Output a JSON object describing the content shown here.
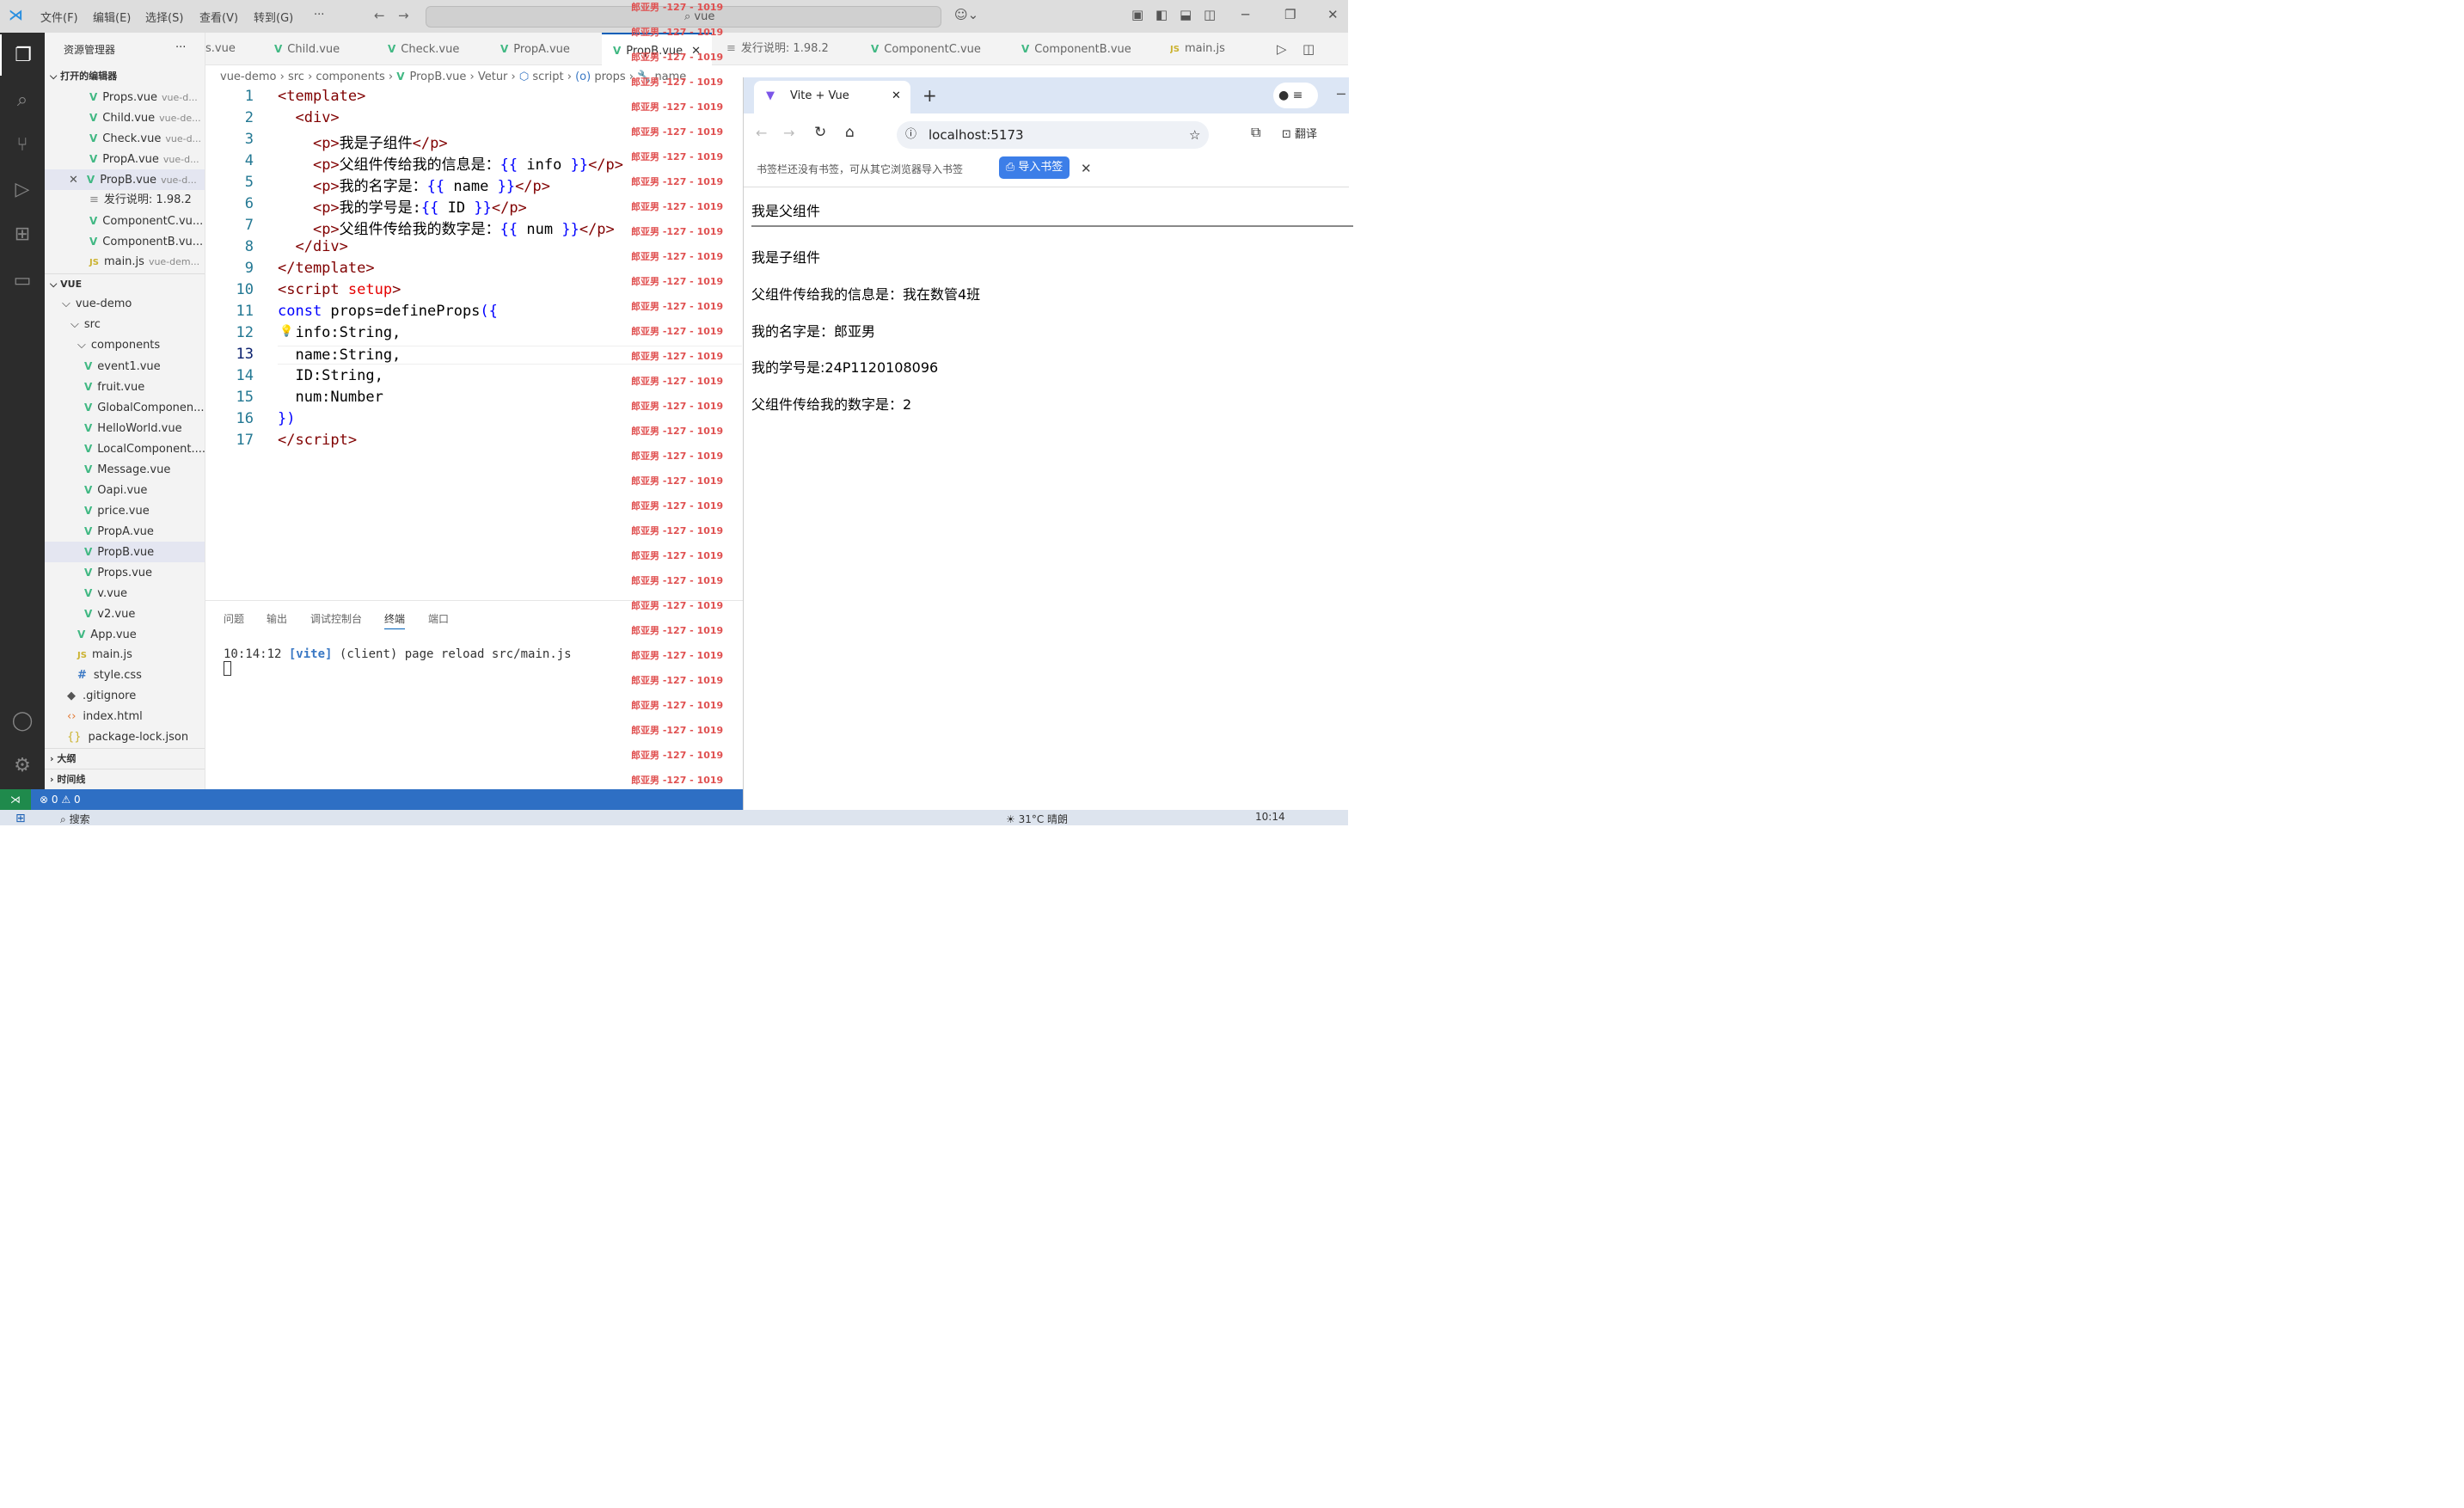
{
  "titlebar": {
    "menus": [
      "文件(F)",
      "编辑(E)",
      "选择(S)",
      "查看(V)",
      "转到(G)",
      "···"
    ],
    "search": "vue"
  },
  "sidebar": {
    "title": "资源管理器",
    "more": "···",
    "open_editors_header": "打开的编辑器",
    "open_editors": [
      {
        "name": "Props.vue",
        "path": "vue-d..."
      },
      {
        "name": "Child.vue",
        "path": "vue-de..."
      },
      {
        "name": "Check.vue",
        "path": "vue-d..."
      },
      {
        "name": "PropA.vue",
        "path": "vue-d..."
      },
      {
        "name": "PropB.vue",
        "path": "vue-d..."
      },
      {
        "name": "发行说明: 1.98.2",
        "path": ""
      },
      {
        "name": "ComponentC.vu...",
        "path": ""
      },
      {
        "name": "ComponentB.vu...",
        "path": ""
      },
      {
        "name": "main.js",
        "path": "vue-dem..."
      }
    ],
    "workspace_header": "VUE",
    "tree": [
      "vue-demo",
      "src",
      "components",
      "event1.vue",
      "fruit.vue",
      "GlobalComponen...",
      "HelloWorld.vue",
      "LocalComponent....",
      "Message.vue",
      "Oapi.vue",
      "price.vue",
      "PropA.vue",
      "PropB.vue",
      "Props.vue",
      "v.vue",
      "v2.vue",
      "App.vue",
      "main.js",
      "style.css",
      ".gitignore",
      "index.html",
      "package-lock.json"
    ],
    "outline": "大纲",
    "timeline": "时间线"
  },
  "tabs": [
    "s.vue",
    "Child.vue",
    "Check.vue",
    "PropA.vue",
    "PropB.vue",
    "发行说明: 1.98.2",
    "ComponentC.vue",
    "ComponentB.vue",
    "main.js"
  ],
  "breadcrumb": [
    "vue-demo",
    "src",
    "components",
    "PropB.vue",
    "Vetur",
    "script",
    "props",
    "name"
  ],
  "code": [
    "1",
    "2",
    "3",
    "4",
    "5",
    "6",
    "7",
    "8",
    "9",
    "10",
    "11",
    "12",
    "13",
    "14",
    "15",
    "16",
    "17"
  ],
  "watermark": "郎亚男 -127 - 1019",
  "panel": {
    "tabs": [
      "问题",
      "输出",
      "调试控制台",
      "终端",
      "端口"
    ],
    "terminal_time": "10:14:12",
    "terminal_tag": "[vite]",
    "terminal_rest": "(client) page reload src/main.js"
  },
  "status": {
    "errors": "0",
    "warnings": "0"
  },
  "browser": {
    "tab_title": "Vite + Vue",
    "url": "localhost:5173",
    "translate": "翻译",
    "bookmark_msg": "书签栏还没有书签，可从其它浏览器导入书签",
    "import_btn": "导入书签",
    "parent_heading": "我是父组件",
    "child_heading": "我是子组件",
    "info_line": "父组件传给我的信息是：我在数管4班",
    "name_line": "我的名字是：郎亚男",
    "id_line": "我的学号是:24P1120108096",
    "num_line": "父组件传给我的数字是：2"
  },
  "taskbar": {
    "search": "搜索",
    "weather": "31°C 晴朗",
    "time": "10:14"
  },
  "colors": {
    "activity": "#2c2c2c",
    "status": "#2e6fc4",
    "vue_green": "#41b883",
    "accent": "#005fb8"
  }
}
